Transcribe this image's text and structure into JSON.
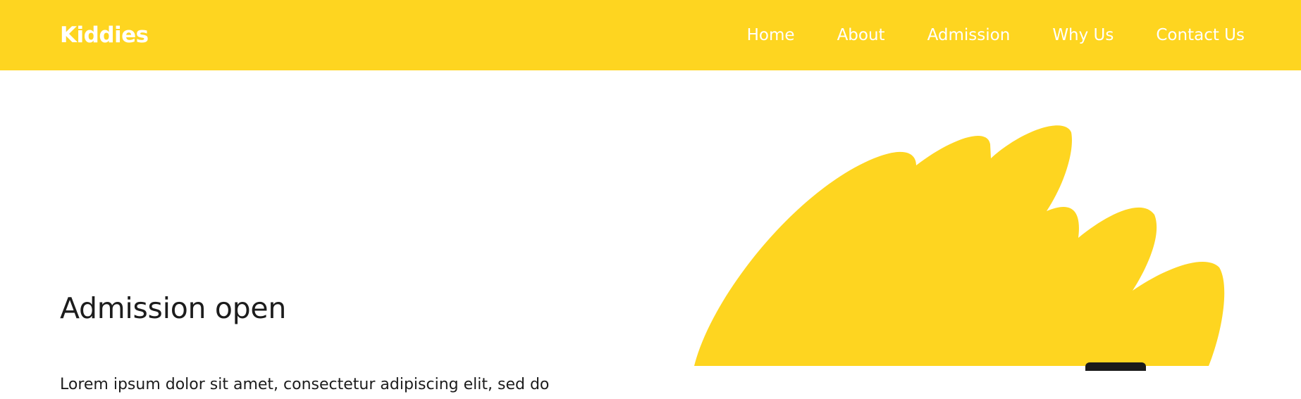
{
  "nav": {
    "brand": "Kiddies",
    "links": [
      {
        "label": "Home"
      },
      {
        "label": "About"
      },
      {
        "label": "Admission"
      },
      {
        "label": "Why Us"
      },
      {
        "label": "Contact Us"
      }
    ]
  },
  "hero": {
    "title": "Admission open",
    "text": "Lorem ipsum dolor sit amet, consectetur adipiscing elit, sed do"
  },
  "colors": {
    "accent": "#fed520",
    "nav_text": "#ffffff",
    "heading": "#1c1c1c"
  }
}
